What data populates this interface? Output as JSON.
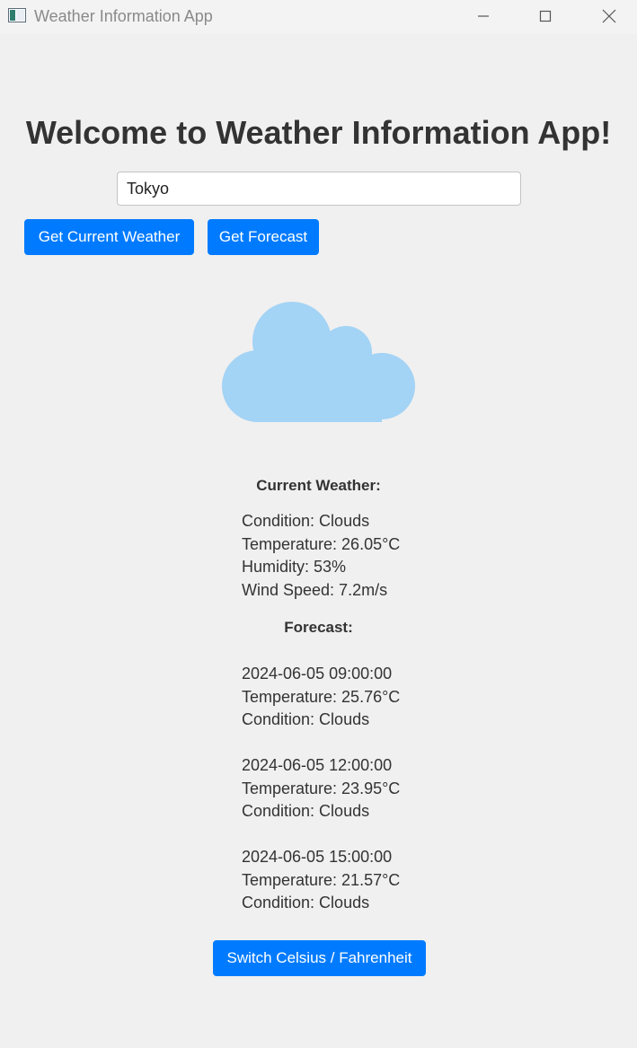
{
  "window": {
    "title": "Weather Information App",
    "icons": {
      "app": "app-window-icon",
      "minimize": "minimize-icon",
      "maximize": "maximize-icon",
      "close": "close-icon"
    }
  },
  "main": {
    "heading": "Welcome to Weather Information App!",
    "city_input": {
      "value": "Tokyo"
    },
    "buttons": {
      "current_weather": "Get Current Weather",
      "forecast": "Get Forecast",
      "switch_units": "Switch Celsius / Fahrenheit"
    },
    "weather_icon": "cloud-icon",
    "current_weather": {
      "title": "Current Weather:",
      "condition": "Condition: Clouds",
      "temperature": "Temperature: 26.05°C",
      "humidity": "Humidity: 53%",
      "wind_speed": "Wind Speed: 7.2m/s"
    },
    "forecast": {
      "title": "Forecast:",
      "items": [
        {
          "datetime": "2024-06-05 09:00:00",
          "temperature": "Temperature: 25.76°C",
          "condition": "Condition: Clouds"
        },
        {
          "datetime": "2024-06-05 12:00:00",
          "temperature": "Temperature: 23.95°C",
          "condition": "Condition: Clouds"
        },
        {
          "datetime": "2024-06-05 15:00:00",
          "temperature": "Temperature: 21.57°C",
          "condition": "Condition: Clouds"
        }
      ]
    }
  },
  "colors": {
    "accent": "#007bff",
    "cloud": "#a3d3f5",
    "background": "#f0f0f0",
    "text": "#333333"
  }
}
